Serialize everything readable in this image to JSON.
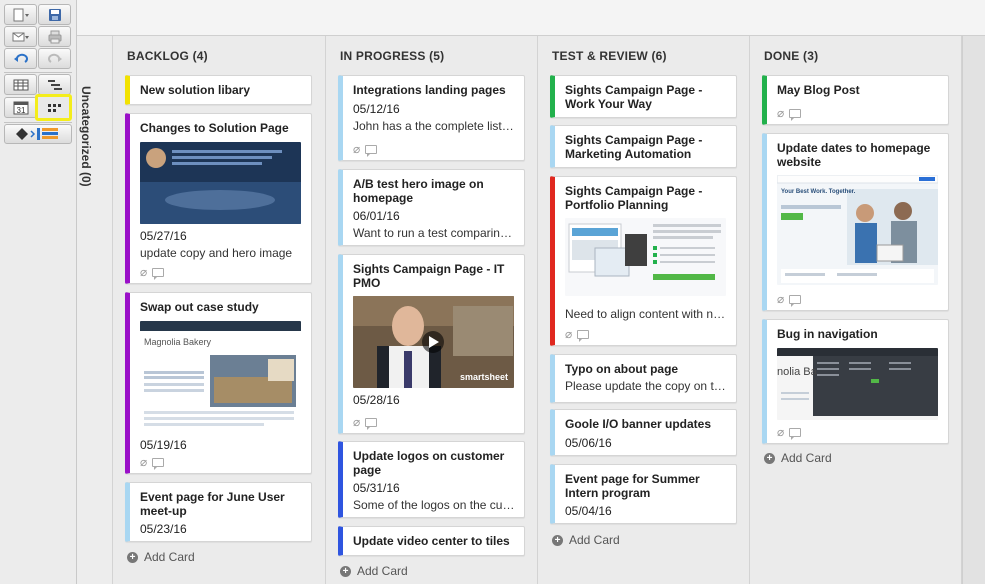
{
  "uncategorized_label": "Uncategorized (0)",
  "colors": {
    "yellow": "#f2e200",
    "purple": "#9a10c8",
    "light_blue": "#a9d7f2",
    "blue": "#2f55e0",
    "green": "#22b14c",
    "red": "#e0281f",
    "highlight": "#f4ed1b"
  },
  "toolbar": {
    "buttons": [
      "new-sheet-icon",
      "save-icon",
      "mail-icon",
      "print-icon",
      "undo-icon",
      "redo-icon",
      "grid-view-icon",
      "gantt-view-icon",
      "calendar-view-icon",
      "card-view-icon",
      "publish-icon"
    ],
    "calendar_day": "31"
  },
  "lanes": [
    {
      "title": "BACKLOG (4)",
      "cards": [
        {
          "title": "New solution libary"
        },
        {
          "title": "Changes to Solution Page",
          "date": "05/27/16",
          "text": "update copy and hero image"
        },
        {
          "title": "Swap out case study",
          "date": "05/19/16",
          "image_text": "Magnolia Bakery"
        },
        {
          "title": "Event page for June User meet-up",
          "date": "05/23/16"
        }
      ],
      "add_label": "Add Card"
    },
    {
      "title": "IN PROGRESS (5)",
      "cards": [
        {
          "title": "Integrations landing pages",
          "date": "05/12/16",
          "text": "John has a the complete list i..."
        },
        {
          "title": "A/B test hero image on homepage",
          "date": "06/01/16",
          "text": "Want to run a test comparing..."
        },
        {
          "title": "Sights Campaign Page - IT PMO",
          "date": "05/28/16",
          "image_text": "smartsheet"
        },
        {
          "title": "Update logos on customer page",
          "date": "05/31/16",
          "text": "Some of the logos on the cus..."
        },
        {
          "title": "Update video center to tiles"
        }
      ],
      "add_label": "Add Card"
    },
    {
      "title": "TEST & REVIEW (6)",
      "cards": [
        {
          "title": "Sights Campaign Page - Work Your Way"
        },
        {
          "title": "Sights Campaign Page - Marketing Automation"
        },
        {
          "title": "Sights Campaign Page - Portfolio Planning",
          "text": "Need to align content with ne..."
        },
        {
          "title": "Typo on about page",
          "text": "Please update the copy on th..."
        },
        {
          "title": "Goole I/O banner updates",
          "date": "05/06/16"
        },
        {
          "title": "Event page for Summer Intern program",
          "date": "05/04/16"
        }
      ],
      "add_label": "Add Card"
    },
    {
      "title": "DONE (3)",
      "cards": [
        {
          "title": "May Blog Post"
        },
        {
          "title": "Update dates to homepage website",
          "image_text": "Your Best Work. Together."
        },
        {
          "title": "Bug in navigation",
          "image_text": "nolia Ba"
        }
      ],
      "add_label": "Add Card"
    }
  ]
}
